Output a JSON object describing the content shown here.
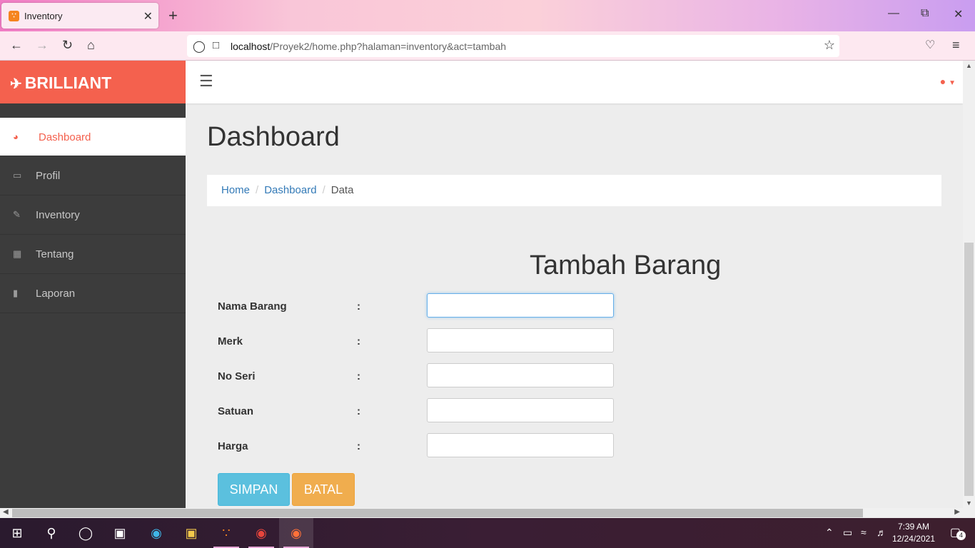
{
  "browser": {
    "tab_title": "Inventory",
    "url_host": "localhost",
    "url_path": "/Proyek2/home.php?halaman=inventory&act=tambah"
  },
  "app": {
    "brand": "BRILLIANT",
    "sidebar": {
      "items": [
        {
          "label": "Dashboard",
          "icon": "dashboard-icon",
          "active": true
        },
        {
          "label": "Profil",
          "icon": "desktop-icon"
        },
        {
          "label": "Inventory",
          "icon": "edit-icon"
        },
        {
          "label": "Tentang",
          "icon": "grid-icon"
        },
        {
          "label": "Laporan",
          "icon": "file-icon"
        }
      ]
    },
    "page_title": "Dashboard",
    "breadcrumb": {
      "home": "Home",
      "dashboard": "Dashboard",
      "current": "Data",
      "separator": "/"
    },
    "form": {
      "title": "Tambah Barang",
      "colon": ":",
      "fields": [
        {
          "label": "Nama Barang",
          "value": ""
        },
        {
          "label": "Merk",
          "value": ""
        },
        {
          "label": "No Seri",
          "value": ""
        },
        {
          "label": "Satuan",
          "value": ""
        },
        {
          "label": "Harga",
          "value": ""
        }
      ],
      "save_label": "SIMPAN",
      "cancel_label": "BATAL"
    }
  },
  "taskbar": {
    "time": "7:39 AM",
    "date": "12/24/2021",
    "notification_count": "4"
  },
  "colors": {
    "brand": "#f4614e",
    "sidebar_bg": "#3c3c3c",
    "save_button": "#5bc0de",
    "cancel_button": "#f0ad4e",
    "link": "#337ab7"
  }
}
